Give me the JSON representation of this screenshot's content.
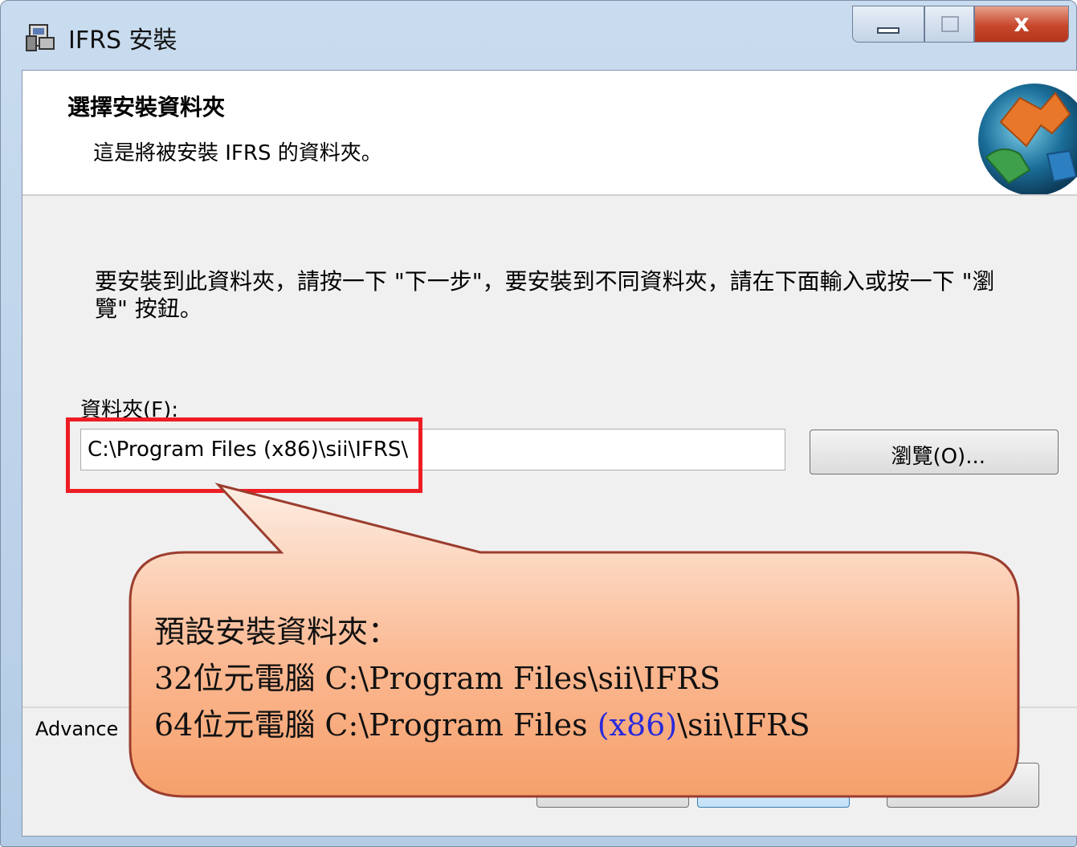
{
  "window": {
    "title": "IFRS 安裝",
    "close_glyph": "x"
  },
  "banner": {
    "title": "選擇安裝資料夾",
    "subtitle": "這是將被安裝 IFRS 的資料夾。",
    "logo_icon": "puzzle-globe-icon"
  },
  "main": {
    "instruction": "要安裝到此資料夾，請按一下 \"下一步\"，要安裝到不同資料夾，請在下面輸入或按一下 \"瀏覽\" 按鈕。",
    "folder_label": "資料夾(F):",
    "folder_value": "C:\\Program Files (x86)\\sii\\IFRS\\",
    "browse_label": "瀏覽(O)...",
    "advanced_label": "Advance"
  },
  "callout": {
    "line1": "預設安裝資料夾：",
    "line2": "32位元電腦  C:\\Program Files\\sii\\IFRS",
    "line3_prefix": "64位元電腦  C:\\Program Files ",
    "line3_highlight": "(x86)",
    "line3_suffix": "\\sii\\IFRS"
  },
  "colors": {
    "highlight_border": "#ee1c24",
    "callout_fill_top": "#fde9d9",
    "callout_fill_bottom": "#f8a978",
    "callout_border": "#9b3d2e",
    "x86_text": "#2a2adb"
  }
}
